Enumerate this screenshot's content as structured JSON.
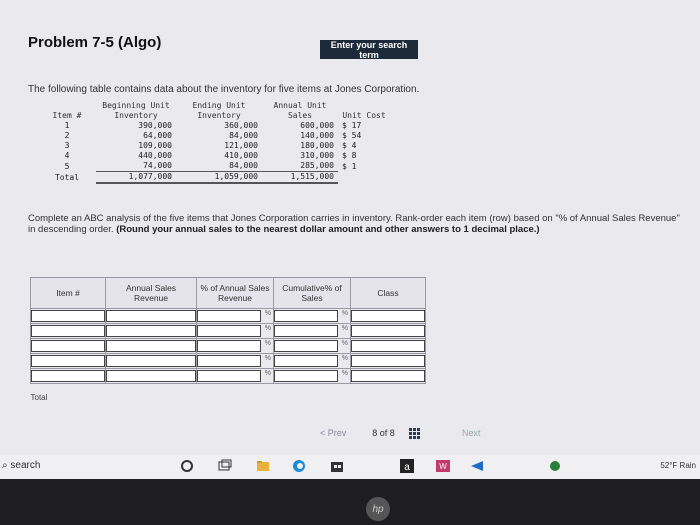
{
  "header": {
    "title": "Problem 7-5 (Algo)",
    "search_button": "Enter your search term"
  },
  "intro": "The following table contains data about the inventory for five items at Jones Corporation.",
  "inventory": {
    "headers": {
      "item": "Item #",
      "beginning": "Beginning Unit Inventory",
      "ending": "Ending Unit Inventory",
      "annual": "Annual Unit Sales",
      "cost": "Unit Cost"
    },
    "rows": [
      {
        "item": "1",
        "beginning": "390,000",
        "ending": "360,000",
        "annual": "600,000",
        "cost": "$ 17"
      },
      {
        "item": "2",
        "beginning": "64,000",
        "ending": "84,000",
        "annual": "140,000",
        "cost": "$ 54"
      },
      {
        "item": "3",
        "beginning": "109,000",
        "ending": "121,000",
        "annual": "180,000",
        "cost": "$ 4"
      },
      {
        "item": "4",
        "beginning": "440,000",
        "ending": "410,000",
        "annual": "310,000",
        "cost": "$ 8"
      },
      {
        "item": "5",
        "beginning": "74,000",
        "ending": "84,000",
        "annual": "285,000",
        "cost": "$ 1"
      }
    ],
    "total": {
      "label": "Total",
      "beginning": "1,077,000",
      "ending": "1,059,000",
      "annual": "1,515,000"
    }
  },
  "instructions": {
    "text": "Complete an ABC analysis of the five items that Jones Corporation carries in inventory. Rank-order each item (row) based on \"% of Annual Sales Revenue\" in descending order.",
    "bold": "(Round your annual sales to the nearest dollar amount and other answers to 1 decimal place.)"
  },
  "abc_table": {
    "headers": {
      "item": "Item #",
      "revenue": "Annual Sales Revenue",
      "pct": "% of Annual Sales Revenue",
      "cumulative": "Cumulative% of Sales",
      "class": "Class"
    },
    "pct_symbol": "%",
    "total_label": "Total"
  },
  "pager": {
    "prev": "< Prev",
    "count": "8 of 8",
    "next": "Next"
  },
  "taskbar": {
    "search": "search",
    "weather": "52°F Rain"
  },
  "bezel": {
    "logo": "hp"
  }
}
